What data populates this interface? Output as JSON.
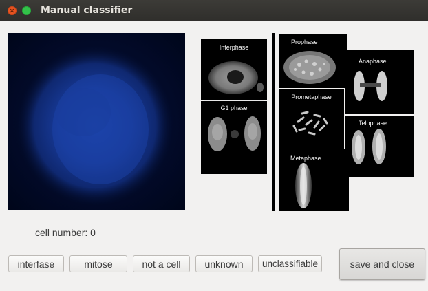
{
  "window": {
    "title": "Manual classifier",
    "buttons": [
      "close-icon",
      "maximize-icon"
    ],
    "colors": {
      "close": "#e95420",
      "maximize": "#33c24a",
      "titlebar": "#3c3b37"
    }
  },
  "cell_image": {
    "colors": {
      "background": "#00061a",
      "nucleus": "#1b3fa0"
    }
  },
  "reference": {
    "panels": [
      {
        "label": "Interphase"
      },
      {
        "label": "G1 phase"
      },
      {
        "label": "Prophase"
      },
      {
        "label": "Prometaphase"
      },
      {
        "label": "Metaphase"
      },
      {
        "label": "Anaphase"
      },
      {
        "label": "Telophase"
      }
    ]
  },
  "status": {
    "cell_number_label": "cell number: 0"
  },
  "actions": {
    "interfase": "interfase",
    "mitose": "mitose",
    "not_a_cell": "not a cell",
    "unknown": "unknown",
    "unclassifiable": "unclassifiable",
    "save_and_close": "save and close"
  }
}
